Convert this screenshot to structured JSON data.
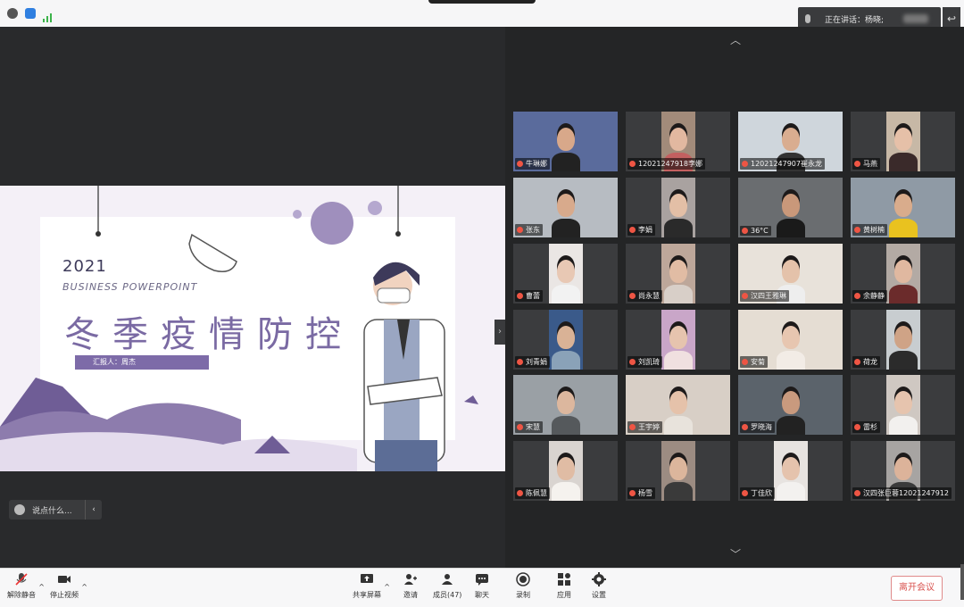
{
  "speaking": {
    "label": "正在讲话：",
    "name": "杨晓;"
  },
  "slide": {
    "year": "2021",
    "subtitle": "BUSINESS  POWERPOINT",
    "title": "冬季疫情防控",
    "presenter": "汇报人：周杰"
  },
  "chat": {
    "placeholder": "说点什么..."
  },
  "participants": [
    {
      "name": "牛琳娜",
      "skin": "#d8a88a",
      "bg": "#5a6b9c",
      "shirt": "#222"
    },
    {
      "name": "12021247918李娜",
      "skin": "#e2b8a0",
      "bg": "#a28b7a",
      "shirt": "#c46060"
    },
    {
      "name": "12021247907崔永龙",
      "skin": "#d9ad90",
      "bg": "#cfd6dc",
      "shirt": "#333"
    },
    {
      "name": "马燕",
      "skin": "#e6c0a8",
      "bg": "#c7b8a6",
      "shirt": "#3a2a2a"
    },
    {
      "name": "张东",
      "skin": "#d8aa8c",
      "bg": "#b7bcc2",
      "shirt": "#222"
    },
    {
      "name": "李娟",
      "skin": "#e3bfa6",
      "bg": "#a9a2a0",
      "shirt": "#2a2a2a"
    },
    {
      "name": "36°C",
      "skin": "#c9987a",
      "bg": "#6a6d70",
      "shirt": "#1a1a1a"
    },
    {
      "name": "黄树楠",
      "skin": "#d9ac8c",
      "bg": "#8f9aa5",
      "shirt": "#e9c21f"
    },
    {
      "name": "曹蕾",
      "skin": "#e8c8b4",
      "bg": "#eae6e4",
      "shirt": "#f2f2f2"
    },
    {
      "name": "尚永慧",
      "skin": "#e1bca4",
      "bg": "#bda79a",
      "shirt": "#d8cfc8"
    },
    {
      "name": "汉四王雅琳",
      "skin": "#e4c2aa",
      "bg": "#e8e2da",
      "shirt": "#eee"
    },
    {
      "name": "余静静",
      "skin": "#e0b8a0",
      "bg": "#b3aaa4",
      "shirt": "#6b2b2b"
    },
    {
      "name": "刘青娟",
      "skin": "#d9b296",
      "bg": "#3a5a8a",
      "shirt": "#8aa2b8"
    },
    {
      "name": "刘凯琦",
      "skin": "#e6c4ae",
      "bg": "#c9a6c8",
      "shirt": "#f0e0e0"
    },
    {
      "name": "安菊",
      "skin": "#e7c6b0",
      "bg": "#e5ddd3",
      "shirt": "#f2ece6"
    },
    {
      "name": "荷龙",
      "skin": "#cfa386",
      "bg": "#c8cdd0",
      "shirt": "#2b2b2b"
    },
    {
      "name": "宋慧",
      "skin": "#dcb79e",
      "bg": "#9aa0a5",
      "shirt": "#55595c"
    },
    {
      "name": "王宇婷",
      "skin": "#e5c2aa",
      "bg": "#d8cfc6",
      "shirt": "#e8e3dc"
    },
    {
      "name": "罗晓海",
      "skin": "#c99a7e",
      "bg": "#5b636b",
      "shirt": "#222"
    },
    {
      "name": "雷杉",
      "skin": "#e6c4ae",
      "bg": "#cfc8c2",
      "shirt": "#f2f0ee"
    },
    {
      "name": "陈佩慧",
      "skin": "#e0bca4",
      "bg": "#d9d4d0",
      "shirt": "#f5f2ee"
    },
    {
      "name": "杨雪",
      "skin": "#dcb69c",
      "bg": "#9c8c82",
      "shirt": "#3a3a3a"
    },
    {
      "name": "丁佳欣",
      "skin": "#e5c3ad",
      "bg": "#e7e3e0",
      "shirt": "#f3f1ef"
    },
    {
      "name": "汉四张巨蓉12021247912",
      "skin": "#dcb39a",
      "bg": "#a7a4a2",
      "shirt": "#3a3a3a"
    }
  ],
  "toolbar": {
    "unmute": "解除静音",
    "stop_video": "停止视频",
    "share_screen": "共享屏幕",
    "invite": "邀请",
    "members": "成员(47)",
    "chat": "聊天",
    "record": "录制",
    "apps": "应用",
    "settings": "设置",
    "leave": "离开会议"
  }
}
